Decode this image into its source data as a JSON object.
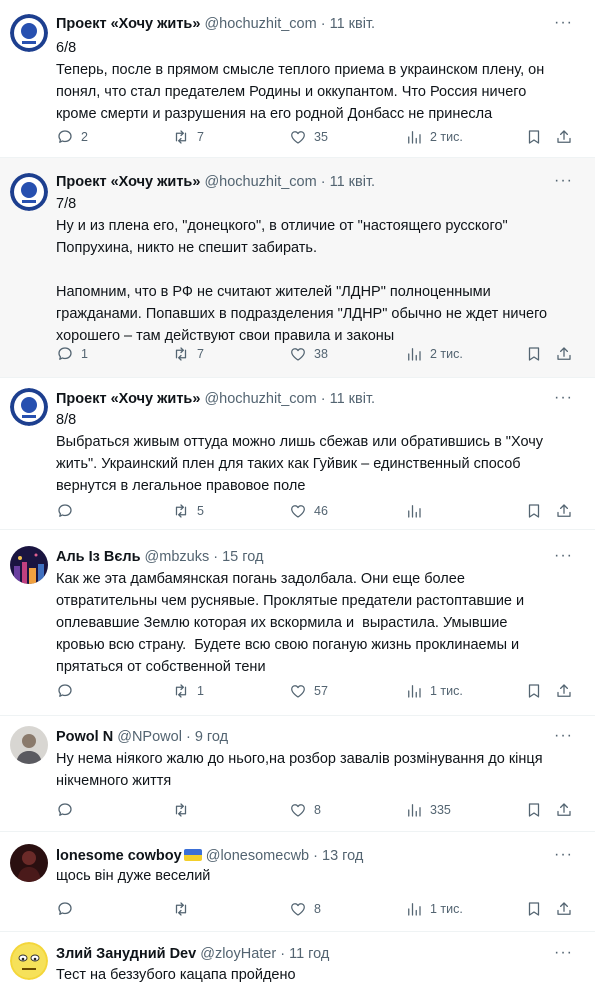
{
  "tweets": [
    {
      "name": "Проект «Хочу жить»",
      "handle": "@hochuzhit_com",
      "time": "11 квіт.",
      "text": "6/8\nТеперь, после в прямом смысле теплого приема в украинском плену, он\nпонял, что стал предателем Родины и оккупантом. Что Россия ничего\nкроме смерти и разрушения на его родной Донбасс не принесла",
      "replies": "2",
      "retweets": "7",
      "likes": "35",
      "views": "2 тис."
    },
    {
      "name": "Проект «Хочу жить»",
      "handle": "@hochuzhit_com",
      "time": "11 квіт.",
      "text": "7/8\nНу и из плена его, \"донецкого\", в отличие от \"настоящего русского\"\nПопрухина, никто не спешит забирать.\n\nНапомним, что в РФ не считают жителей \"ЛДНР\" полноценными\nгражданами. Попавших в подразделения \"ЛДНР\" обычно не ждет ничего\nхорошего – там действуют свои правила и законы",
      "replies": "1",
      "retweets": "7",
      "likes": "38",
      "views": "2 тис."
    },
    {
      "name": "Проект «Хочу жить»",
      "handle": "@hochuzhit_com",
      "time": "11 квіт.",
      "text": "8/8\nВыбраться живым оттуда можно лишь сбежав или обратившись в \"Хочу\nжить\". Украинский плен для таких как Гуйвик – единственный способ\nвернутся в легальное правовое поле",
      "replies": "",
      "retweets": "5",
      "likes": "46",
      "views": ""
    },
    {
      "name": "Аль Із Вєль",
      "handle": "@mbzuks",
      "time": "15 год",
      "text": "Как же эта дамбамянская погань задолбала. Они еще более\nотвратительны чем руснявые. Проклятые предатели растоптавшие и\nоплевавшие Землю которая их вскормила и  вырастила. Умывшие\nкровью всю страну.  Будете всю свою поганую жизнь проклинаемы и\nпрятаться от собственной тени",
      "replies": "",
      "retweets": "1",
      "likes": "57",
      "views": "1 тис."
    },
    {
      "name": "Powol N",
      "handle": "@NPowol",
      "time": "9 год",
      "text": "Ну нема ніякого жалю до нього,на розбор завалів розмінування до кінця\nнікчемного життя",
      "replies": "",
      "retweets": "",
      "likes": "8",
      "views": "335"
    },
    {
      "name": "lonesome cowboy",
      "handle": "@lonesomecwb",
      "time": "13 год",
      "text": "щось він дуже веселий",
      "replies": "",
      "retweets": "",
      "likes": "8",
      "views": "1 тис."
    },
    {
      "name": "Злий Занудний Dev",
      "handle": "@zloyHater",
      "time": "11 год",
      "text": "Тест на беззубого кацапа пройдено",
      "replies": "",
      "retweets": "",
      "likes": "",
      "views": ""
    }
  ],
  "colors": {
    "text": "#0f1419",
    "muted": "#536471",
    "highlight_bg": "#f7f7f7",
    "divider": "#eff3f4"
  },
  "icons": [
    "reply-icon",
    "retweet-icon",
    "like-icon",
    "views-icon",
    "bookmark-icon",
    "share-icon",
    "more-icon"
  ]
}
